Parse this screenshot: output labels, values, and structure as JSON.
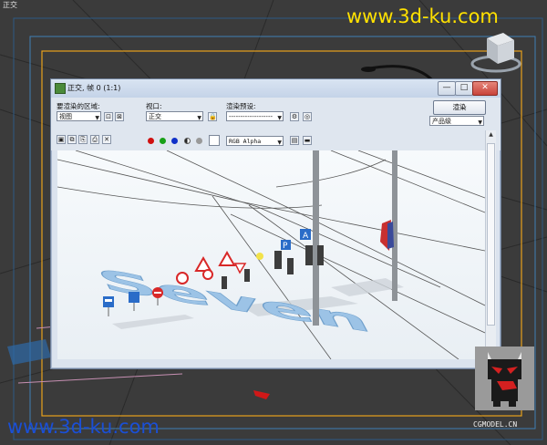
{
  "viewport": {
    "label": "正交",
    "watermark_top": "www.3d-ku.com",
    "watermark_bottom": "www.3d-ku.com",
    "corner_brand": "CGMODEL.CN"
  },
  "render_window": {
    "title": "正交, 帧 0 (1:1)",
    "controls": {
      "minimize": "—",
      "maximize": "□",
      "close": "✕"
    },
    "area_label": "要渲染的区域:",
    "area_value": "视图",
    "viewport_label": "视口:",
    "viewport_value": "正交",
    "preset_label": "渲染预设:",
    "preset_value": "-------------------",
    "render_button": "渲染",
    "quality_value": "产品级",
    "channel_value": "RGB Alpha"
  },
  "colors": {
    "channel_red": "#d01010",
    "channel_green": "#18a018",
    "channel_blue": "#1030c8",
    "watermark_yellow": "#ffe100",
    "watermark_blue": "#1a4fd6"
  },
  "scene": {
    "floor_text": "Seven"
  },
  "icons": [
    "save-icon",
    "copy-icon",
    "clone-icon",
    "print-icon",
    "clear-icon",
    "lock-icon",
    "mono-icon",
    "scroll-up-icon",
    "scroll-down-icon",
    "viewcube-icon",
    "mascot-logo-icon"
  ]
}
